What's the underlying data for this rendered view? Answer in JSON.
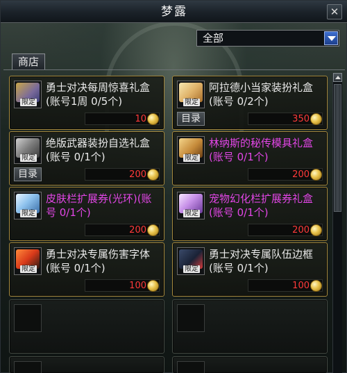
{
  "window": {
    "title": "梦露",
    "close_glyph": "✕"
  },
  "filter": {
    "selected": "全部"
  },
  "tabs": [
    {
      "label": "商店"
    }
  ],
  "items": [
    {
      "name": "勇士对决每周惊喜礼盒(账号1周 0/5个)",
      "price": "10",
      "limited": true,
      "badge": "限定",
      "name_color": "white",
      "icon": "gift-box-icon",
      "catalog": ""
    },
    {
      "name": "阿拉德小当家装扮礼盒(账号 0/2个)",
      "price": "350",
      "limited": true,
      "badge": "限定",
      "name_color": "white",
      "icon": "gift-box-icon",
      "catalog": "目录"
    },
    {
      "name": "绝版武器装扮自选礼盒(账号 0/1个)",
      "price": "200",
      "limited": true,
      "badge": "限定",
      "name_color": "white",
      "icon": "weapon-box-icon",
      "catalog": "目录"
    },
    {
      "name": "林纳斯的秘传模具礼盒(账号 0/1个)",
      "price": "200",
      "limited": true,
      "badge": "限定",
      "name_color": "purple",
      "icon": "mold-scroll-icon",
      "catalog": ""
    },
    {
      "name": "皮肤栏扩展券(光环)(账号 0/1个)",
      "price": "200",
      "limited": true,
      "badge": "限定",
      "name_color": "purple",
      "icon": "ticket-icon",
      "catalog": ""
    },
    {
      "name": "宠物幻化栏扩展券礼盒(账号 0/1个)",
      "price": "200",
      "limited": true,
      "badge": "限定",
      "name_color": "purple",
      "icon": "ticket-icon",
      "catalog": ""
    },
    {
      "name": "勇士对决专属伤害字体(账号 0/1个)",
      "price": "100",
      "limited": true,
      "badge": "限定",
      "name_color": "white",
      "icon": "damage-font-icon",
      "catalog": ""
    },
    {
      "name": "勇士对决专属队伍边框(账号 0/1个)",
      "price": "100",
      "limited": true,
      "badge": "限定",
      "name_color": "white",
      "icon": "party-frame-icon",
      "catalog": ""
    }
  ],
  "colors": {
    "price": "#ff3a3a",
    "purple_name": "#e246e6",
    "card_border": "#a68a3e",
    "dropdown_accent": "#3e6fd1"
  }
}
